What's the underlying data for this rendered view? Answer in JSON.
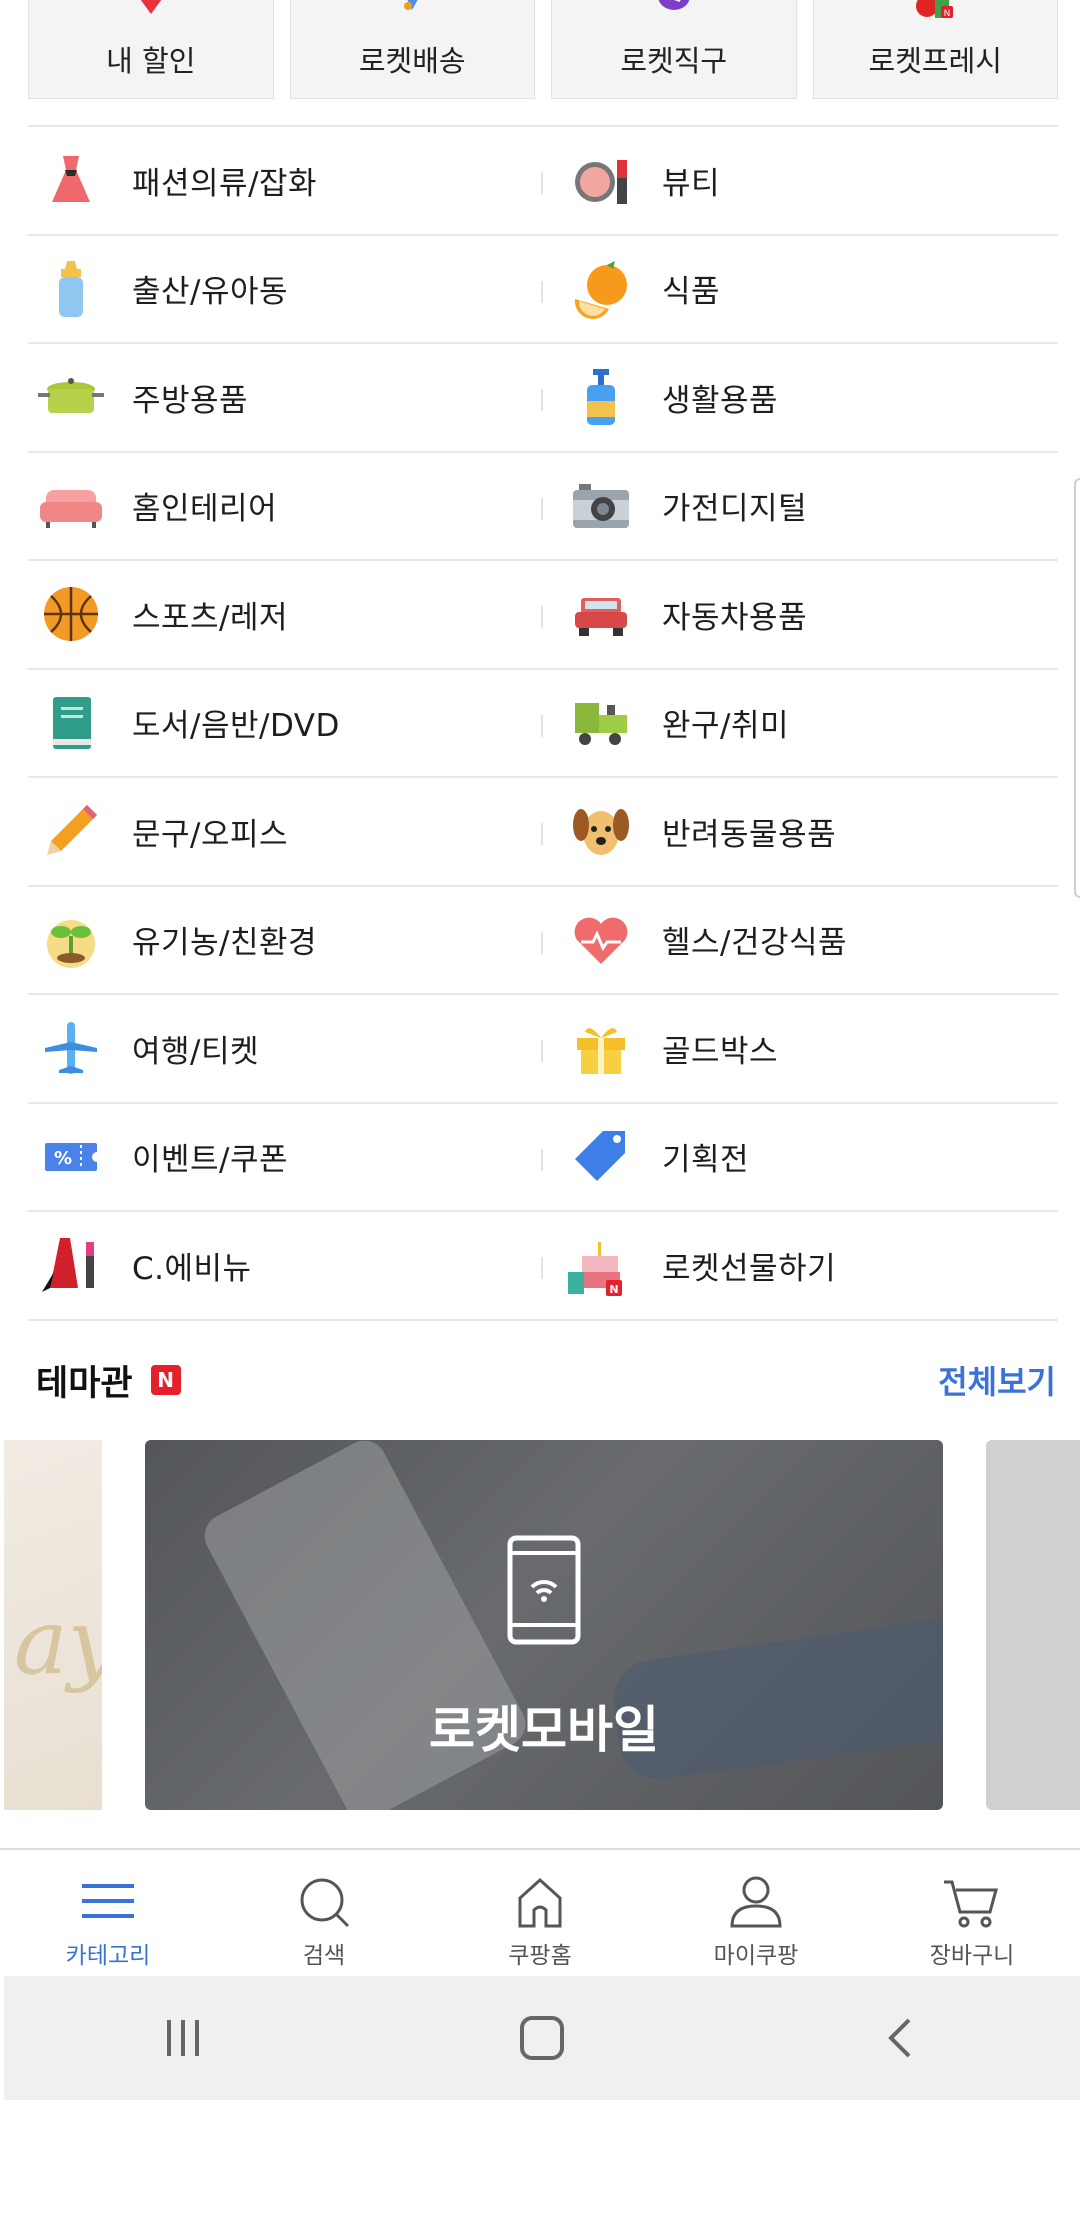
{
  "quick_tabs": [
    {
      "label": "내 할인",
      "icon": "tag-icon"
    },
    {
      "label": "로켓배송",
      "icon": "rocket-icon"
    },
    {
      "label": "로켓직구",
      "icon": "rocket-global-icon"
    },
    {
      "label": "로켓프레시",
      "icon": "fresh-produce-icon"
    }
  ],
  "categories": [
    {
      "left": {
        "label": "패션의류/잡화",
        "icon": "dress-icon"
      },
      "right": {
        "label": "뷰티",
        "icon": "cosmetics-icon"
      }
    },
    {
      "left": {
        "label": "출산/유아동",
        "icon": "baby-bottle-icon"
      },
      "right": {
        "label": "식품",
        "icon": "orange-icon"
      }
    },
    {
      "left": {
        "label": "주방용품",
        "icon": "cooking-pot-icon"
      },
      "right": {
        "label": "생활용품",
        "icon": "pump-bottle-icon"
      }
    },
    {
      "left": {
        "label": "홈인테리어",
        "icon": "sofa-icon"
      },
      "right": {
        "label": "가전디지털",
        "icon": "camera-icon"
      }
    },
    {
      "left": {
        "label": "스포츠/레저",
        "icon": "basketball-icon"
      },
      "right": {
        "label": "자동차용품",
        "icon": "car-icon"
      }
    },
    {
      "left": {
        "label": "도서/음반/DVD",
        "icon": "book-icon"
      },
      "right": {
        "label": "완구/취미",
        "icon": "toy-train-icon"
      }
    },
    {
      "left": {
        "label": "문구/오피스",
        "icon": "pencil-icon"
      },
      "right": {
        "label": "반려동물용품",
        "icon": "dog-icon"
      }
    },
    {
      "left": {
        "label": "유기농/친환경",
        "icon": "sprout-icon"
      },
      "right": {
        "label": "헬스/건강식품",
        "icon": "heart-pulse-icon"
      }
    },
    {
      "left": {
        "label": "여행/티켓",
        "icon": "airplane-icon"
      },
      "right": {
        "label": "골드박스",
        "icon": "gift-box-icon"
      }
    },
    {
      "left": {
        "label": "이벤트/쿠폰",
        "icon": "coupon-icon"
      },
      "right": {
        "label": "기획전",
        "icon": "price-tag-icon"
      }
    },
    {
      "left": {
        "label": "C.에비뉴",
        "icon": "luxury-fashion-icon"
      },
      "right": {
        "label": "로켓선물하기",
        "icon": "cake-gift-icon"
      }
    }
  ],
  "theme": {
    "title": "테마관",
    "badge": "N",
    "view_all": "전체보기",
    "card_label": "로켓모바일"
  },
  "bottom_nav": [
    {
      "label": "카테고리",
      "icon": "menu-icon",
      "active": true
    },
    {
      "label": "검색",
      "icon": "search-icon",
      "active": false
    },
    {
      "label": "쿠팡홈",
      "icon": "home-icon",
      "active": false
    },
    {
      "label": "마이쿠팡",
      "icon": "user-icon",
      "active": false
    },
    {
      "label": "장바구니",
      "icon": "cart-icon",
      "active": false
    }
  ],
  "colors": {
    "accent": "#3a72d8",
    "badge": "#e4202a",
    "divider": "#e8e8e8"
  }
}
